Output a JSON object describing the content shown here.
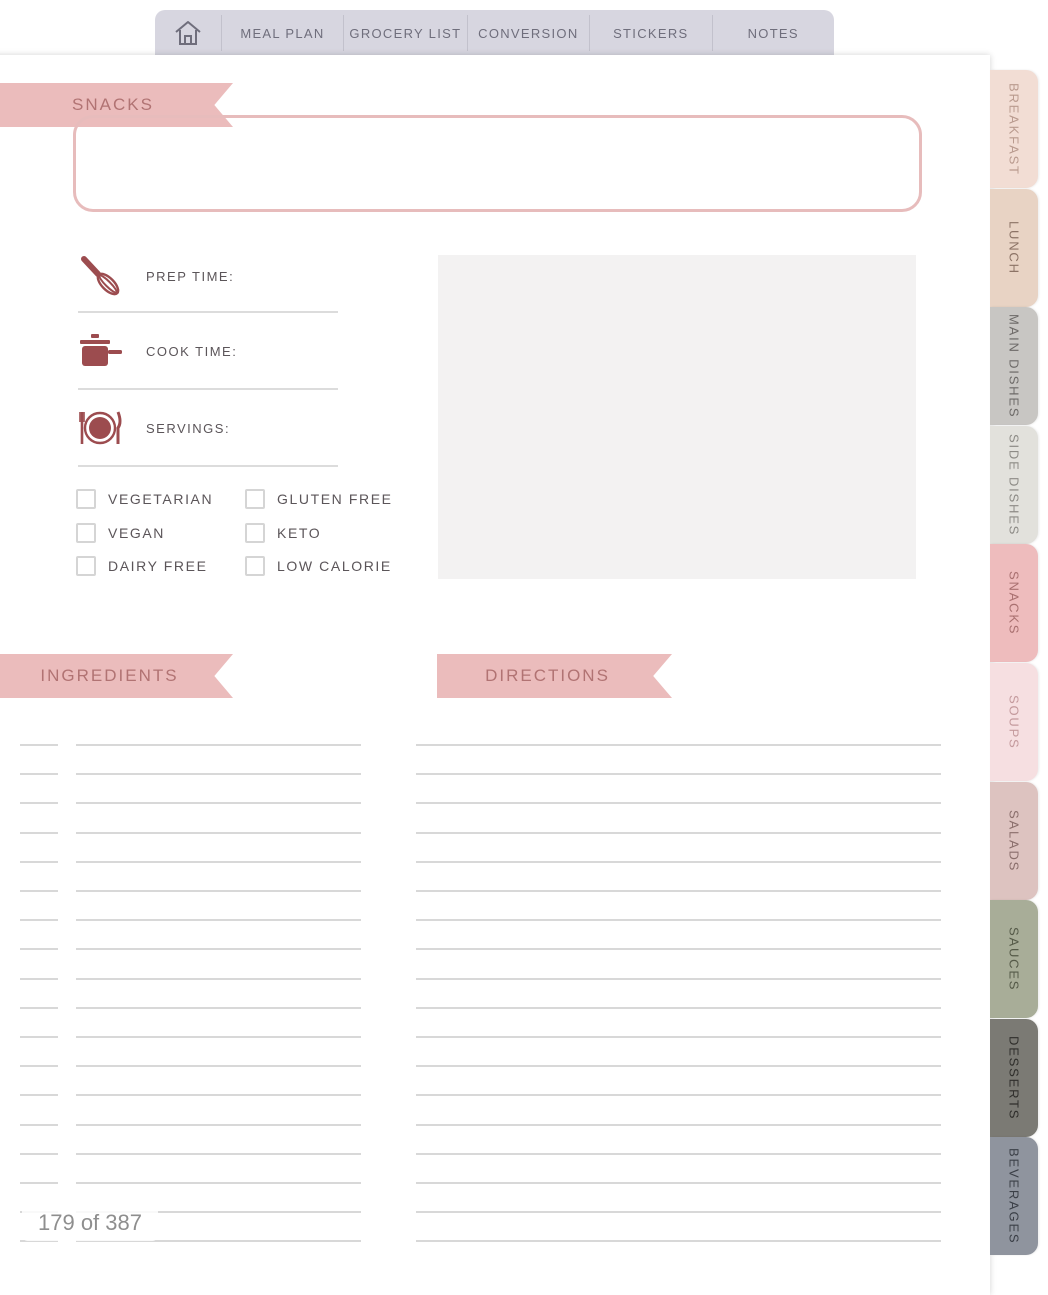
{
  "nav": {
    "tabs": [
      "MEAL PLAN",
      "GROCERY LIST",
      "CONVERSION",
      "STICKERS",
      "NOTES"
    ]
  },
  "recipe": {
    "category_ribbon": "SNACKS",
    "prep_label": "PREP TIME:",
    "cook_label": "COOK TIME:",
    "servings_label": "SERVINGS:",
    "diet_options": [
      "VEGETARIAN",
      "GLUTEN FREE",
      "VEGAN",
      "KETO",
      "DAIRY FREE",
      "LOW CALORIE"
    ],
    "ingredients_label": "INGREDIENTS",
    "directions_label": "DIRECTIONS"
  },
  "side_tabs": [
    {
      "label": "BREAKFAST",
      "bg": "#f2ddd4",
      "fg": "#b99a8e"
    },
    {
      "label": "LUNCH",
      "bg": "#e8d3c4",
      "fg": "#8c7366"
    },
    {
      "label": "MAIN DISHES",
      "bg": "#c8c6c3",
      "fg": "#6d6a68"
    },
    {
      "label": "SIDE DISHES",
      "bg": "#e2e1dc",
      "fg": "#8d8b86"
    },
    {
      "label": "SNACKS",
      "bg": "#eebcbd",
      "fg": "#a97070"
    },
    {
      "label": "SOUPS",
      "bg": "#f6dfe1",
      "fg": "#c49a9d"
    },
    {
      "label": "SALADS",
      "bg": "#ddc3c0",
      "fg": "#8a6e6b"
    },
    {
      "label": "SAUCES",
      "bg": "#a8ad98",
      "fg": "#555a48"
    },
    {
      "label": "DESSERTS",
      "bg": "#7b7a74",
      "fg": "#2f2e2b"
    },
    {
      "label": "BEVERAGES",
      "bg": "#8f949e",
      "fg": "#3b3f47"
    }
  ],
  "page_indicator": "179 of 387",
  "colors": {
    "accent_pink": "#ebbcbc",
    "icon_maroon": "#9c4c4f",
    "tabbar_bg": "#d7d6e0"
  }
}
